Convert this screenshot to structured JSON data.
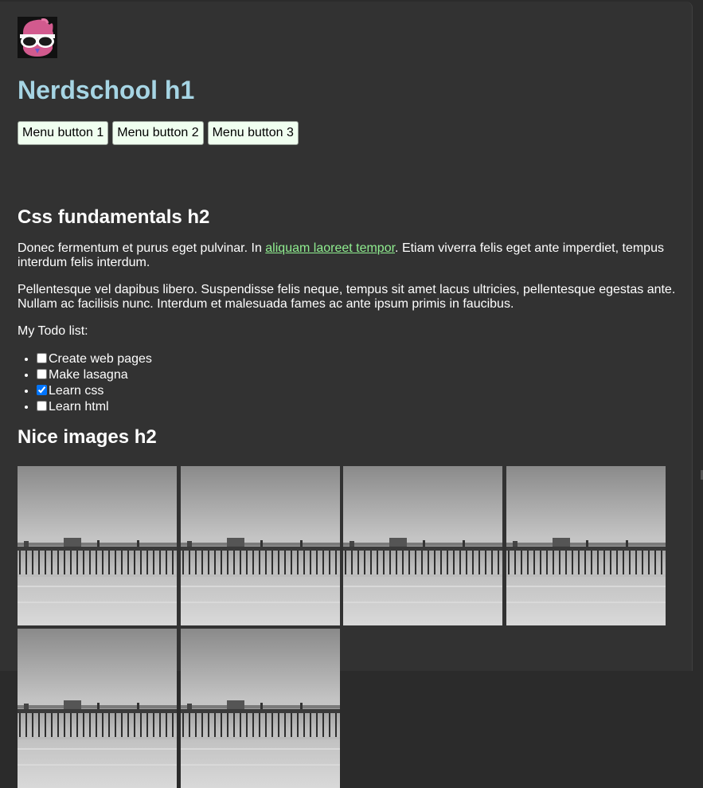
{
  "header": {
    "logo_icon": "nerdschool-owl-logo-icon",
    "title": "Nerdschool h1"
  },
  "menu": {
    "buttons": [
      "Menu button 1",
      "Menu button 2",
      "Menu button 3"
    ]
  },
  "section_css": {
    "heading": "Css fundamentals h2",
    "paragraph1": {
      "before": "Donec fermentum et purus eget pulvinar. In ",
      "link": "aliquam laoreet tempor",
      "after": ". Etiam viverra felis eget ante imperdiet, tempus interdum felis interdum."
    },
    "paragraph2": "Pellentesque vel dapibus libero. Suspendisse felis neque, tempus sit amet lacus ultricies, pellentesque egestas ante. Nullam ac facilisis nunc. Interdum et malesuada fames ac ante ipsum primis in faucibus.",
    "todo_label": "My Todo list:",
    "todo": [
      {
        "label": "Create web pages",
        "checked": false
      },
      {
        "label": "Make lasagna",
        "checked": false
      },
      {
        "label": "Learn css",
        "checked": true
      },
      {
        "label": "Learn html",
        "checked": false
      }
    ]
  },
  "section_images": {
    "heading": "Nice images h2",
    "image_count": 6,
    "image_subject": "pier-photo"
  },
  "colors": {
    "background": "#323232",
    "heading_h1": "#a6d5e4",
    "link": "#90ee90",
    "button_bg": "#f0fff0"
  }
}
